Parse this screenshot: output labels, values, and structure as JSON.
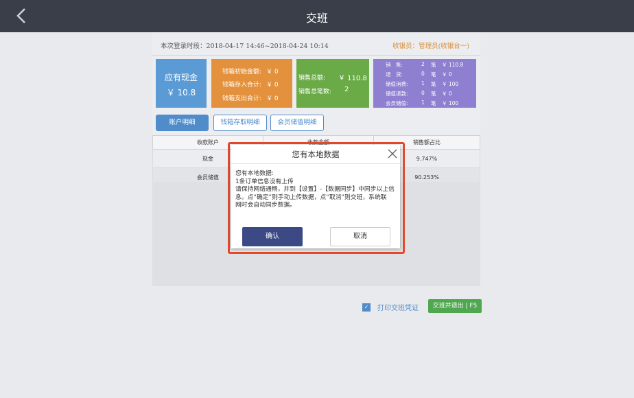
{
  "header": {
    "title": "交班"
  },
  "login": {
    "period": "本次登录时段：2018-04-17 14:46~2018-04-24 10:14",
    "cashier": "收银员：管理员(收银台一)"
  },
  "cards": {
    "cash": {
      "label": "应有现金",
      "value": "￥ 10.8"
    },
    "box": {
      "rows": [
        {
          "label": "钱箱初始金额:",
          "value": "￥ 0"
        },
        {
          "label": "钱箱存入合计:",
          "value": "￥ 0"
        },
        {
          "label": "钱箱支出合计:",
          "value": "￥ 0"
        }
      ]
    },
    "sales": {
      "total_label": "销售总额:",
      "total_value": "￥ 110.8",
      "count_label": "销售总笔数:",
      "count_value": "2"
    },
    "detail": {
      "rows": [
        {
          "label": "销　售:",
          "count": "2",
          "unit": "笔",
          "amount": "￥ 110.8"
        },
        {
          "label": "退　货:",
          "count": "0",
          "unit": "笔",
          "amount": "￥ 0"
        },
        {
          "label": "储值消费:",
          "count": "1",
          "unit": "笔",
          "amount": "￥ 100"
        },
        {
          "label": "储值退款:",
          "count": "0",
          "unit": "笔",
          "amount": "￥ 0"
        },
        {
          "label": "会员储值:",
          "count": "1",
          "unit": "笔",
          "amount": "￥ 100"
        }
      ]
    }
  },
  "tabs": [
    "账户明细",
    "钱箱存取明细",
    "会员储值明细"
  ],
  "table": {
    "headers": [
      "收款账户",
      "收款金额",
      "销售额占比"
    ],
    "rows": [
      [
        "现金",
        "",
        "9.747%"
      ],
      [
        "会员储值",
        "",
        "90.253%"
      ]
    ]
  },
  "footer": {
    "print_label": "打印交班凭证",
    "exit_label": "交班并退出 | F5"
  },
  "dialog": {
    "title": "您有本地数据",
    "lines": [
      "您有本地数据:",
      "1条订单信息没有上传",
      "请保持网络通畅，并到【设置】-【数据同步】中同步以上信",
      "息。点“确定”则手动上传数据，点“取消”则交班，系统联",
      "网时会自动同步数据。"
    ],
    "confirm_label": "确认",
    "cancel_label": "取消"
  },
  "colors": {
    "topbar": "#3a3e48",
    "cash_card": "#5b9bd5",
    "box_card": "#e3913c",
    "sales_card": "#6aab47",
    "detail_card": "#8e7fd0",
    "highlight": "#e4492b",
    "confirm_button": "#3b4a85"
  }
}
